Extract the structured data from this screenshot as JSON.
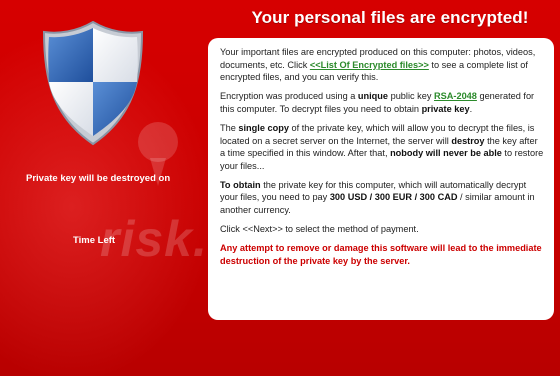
{
  "title": "Your personal files are encrypted!",
  "left": {
    "destroy_label": "Private key will be destroyed on",
    "timeleft_label": "Time Left"
  },
  "message": {
    "p1_a": "Your important files are encrypted produced on this computer: photos, videos, documents, etc. Click ",
    "p1_link": "<<List Of Encrypted files>>",
    "p1_b": " to see a complete list of encrypted files, and you can verify this.",
    "p2_a": "Encryption was produced using a ",
    "p2_bold1": "unique",
    "p2_b": " public key ",
    "p2_link": "RSA-2048",
    "p2_c": " generated for this computer. To decrypt files you need to obtain ",
    "p2_bold2": "private key",
    "p2_d": ".",
    "p3_a": "The ",
    "p3_bold1": "single copy",
    "p3_b": " of the private key, which will allow you to decrypt the files, is located on a secret server on the Internet, the server will ",
    "p3_bold2": "destroy",
    "p3_c": " the key after a time specified in this window. After that, ",
    "p3_bold3": "nobody will never be able",
    "p3_d": " to restore your files...",
    "p4_bold1": "To obtain",
    "p4_a": " the private key for this computer, which will automatically decrypt your files, you need to pay ",
    "p4_bold2": "300 USD / 300 EUR / 300 CAD",
    "p4_b": " / similar amount in another currency.",
    "p5": "Click <<Next>> to select the method of payment.",
    "warning": "Any attempt to remove or damage this software will lead to the immediate destruction of the private key by the server."
  },
  "watermark": "risk.com",
  "colors": {
    "background": "#cc0000",
    "link": "#2b8a2b",
    "warning": "#cc0000",
    "panel": "#ffffff"
  },
  "icons": {
    "shield": "shield-icon"
  }
}
